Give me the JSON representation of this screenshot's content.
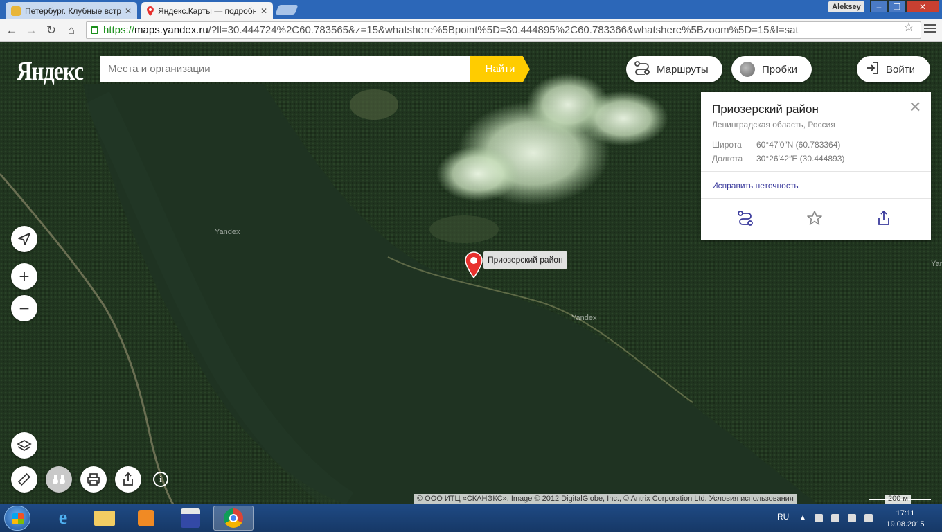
{
  "browser": {
    "tabs": [
      {
        "title": "Петербург. Клубные встр",
        "active": false
      },
      {
        "title": "Яндекс.Карты — подробн",
        "active": true
      }
    ],
    "user": "Aleksey",
    "url_scheme": "https://",
    "url_host": "maps.yandex.ru",
    "url_path": "/?ll=30.444724%2C60.783565&z=15&whatshere%5Bpoint%5D=30.444895%2C60.783366&whatshere%5Bzoom%5D=15&l=sat"
  },
  "header": {
    "logo": "Яндекс",
    "search_placeholder": "Места и организации",
    "search_button": "Найти",
    "routes_label": "Маршруты",
    "traffic_label": "Пробки",
    "login_label": "Войти"
  },
  "map": {
    "watermarks": [
      "Yandex",
      "Yandex",
      "Yan"
    ],
    "pin_label": "Приозерский район",
    "copyright": "© ООО ИТЦ «СКАНЭКС», Image © 2012 DigitalGlobe, Inc., © Antrix Corporation Ltd.",
    "terms_link": "Условия использования",
    "scale_label": "200 м"
  },
  "panel": {
    "title": "Приозерский район",
    "subtitle": "Ленинградская область, Россия",
    "lat_label": "Широта",
    "lat_value": "60°47′0″N (60.783364)",
    "lon_label": "Долгота",
    "lon_value": "30°26′42″E (30.444893)",
    "fix_link": "Исправить неточность"
  },
  "taskbar": {
    "lang": "RU",
    "time": "17:11",
    "date": "19.08.2015"
  },
  "colors": {
    "accent_yellow": "#ffcc00",
    "pin_red": "#e8312e",
    "link_blue": "#3a3a9c",
    "water": "#1f3322",
    "forest": "#22351f"
  }
}
